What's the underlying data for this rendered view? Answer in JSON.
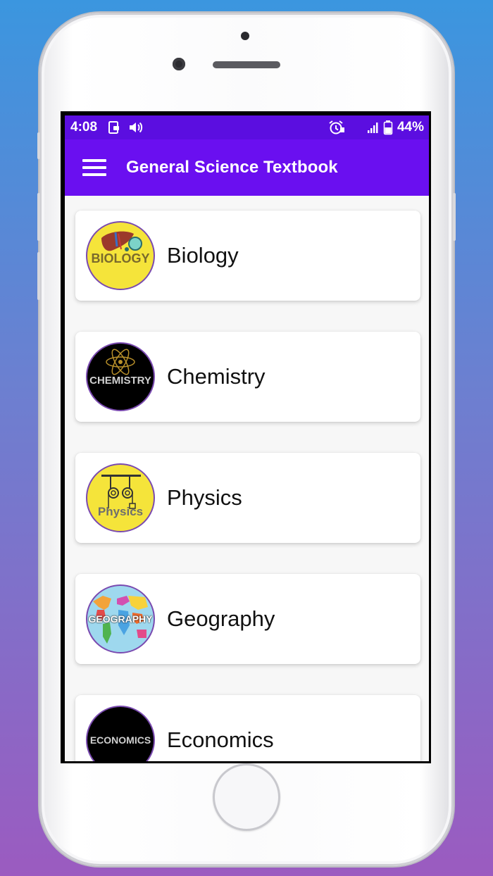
{
  "status_bar": {
    "time": "4:08",
    "battery_percent": "44%",
    "icons": [
      "sim-card-icon",
      "volume-icon",
      "alarm-icon",
      "signal-icon",
      "battery-icon"
    ]
  },
  "app_bar": {
    "title": "General Science Textbook",
    "menu_icon": "hamburger-menu-icon"
  },
  "colors": {
    "status_bar": "#5b0ee0",
    "app_bar": "#6a0ff0",
    "background_top": "#3b96df",
    "background_bottom": "#9b5bc0"
  },
  "subjects": [
    {
      "label": "Biology",
      "avatar_text": "BIOLOGY",
      "avatar_bg": "#f5e43a"
    },
    {
      "label": "Chemistry",
      "avatar_text": "CHEMISTRY",
      "avatar_bg": "#000000"
    },
    {
      "label": "Physics",
      "avatar_text": "Physics",
      "avatar_bg": "#f5e43a"
    },
    {
      "label": "Geography",
      "avatar_text": "GEOGRAPHY",
      "avatar_bg": "#9ed8ee"
    },
    {
      "label": "Economics",
      "avatar_text": "ECONOMICS",
      "avatar_bg": "#000000"
    }
  ]
}
